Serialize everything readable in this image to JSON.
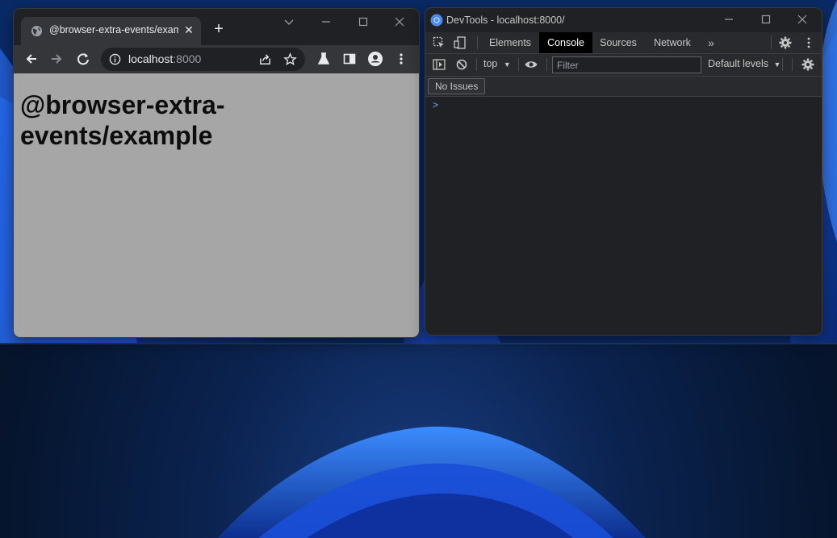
{
  "browser": {
    "tab_title": "@browser-extra-events/example",
    "new_tab_symbol": "+",
    "tab_close_symbol": "✕",
    "url_host": "localhost",
    "url_port": ":8000",
    "page_heading": "@browser-extra-events/example",
    "page_background": "#a6a6a6"
  },
  "devtools": {
    "window_title": "DevTools - localhost:8000/",
    "tabs": [
      "Elements",
      "Console",
      "Sources",
      "Network"
    ],
    "active_tab": "Console",
    "more_tabs_symbol": "»",
    "context_selector": "top",
    "filter_placeholder": "Filter",
    "levels_label": "Default levels",
    "issues_label": "No Issues",
    "prompt_symbol": ">"
  },
  "icons": {
    "tab_favicon": "globe-icon",
    "back": "back-arrow-icon",
    "forward": "forward-arrow-icon",
    "reload": "reload-icon",
    "site_info": "info-icon",
    "share": "share-icon",
    "bookmark": "star-icon",
    "labs": "flask-icon",
    "side_panel": "side-panel-icon",
    "profile": "profile-icon",
    "menu": "kebab-menu-icon"
  },
  "colors": {
    "accent": "#7cacf8",
    "chrome_dark": "#202124",
    "active_tab_bg": "#000000"
  }
}
